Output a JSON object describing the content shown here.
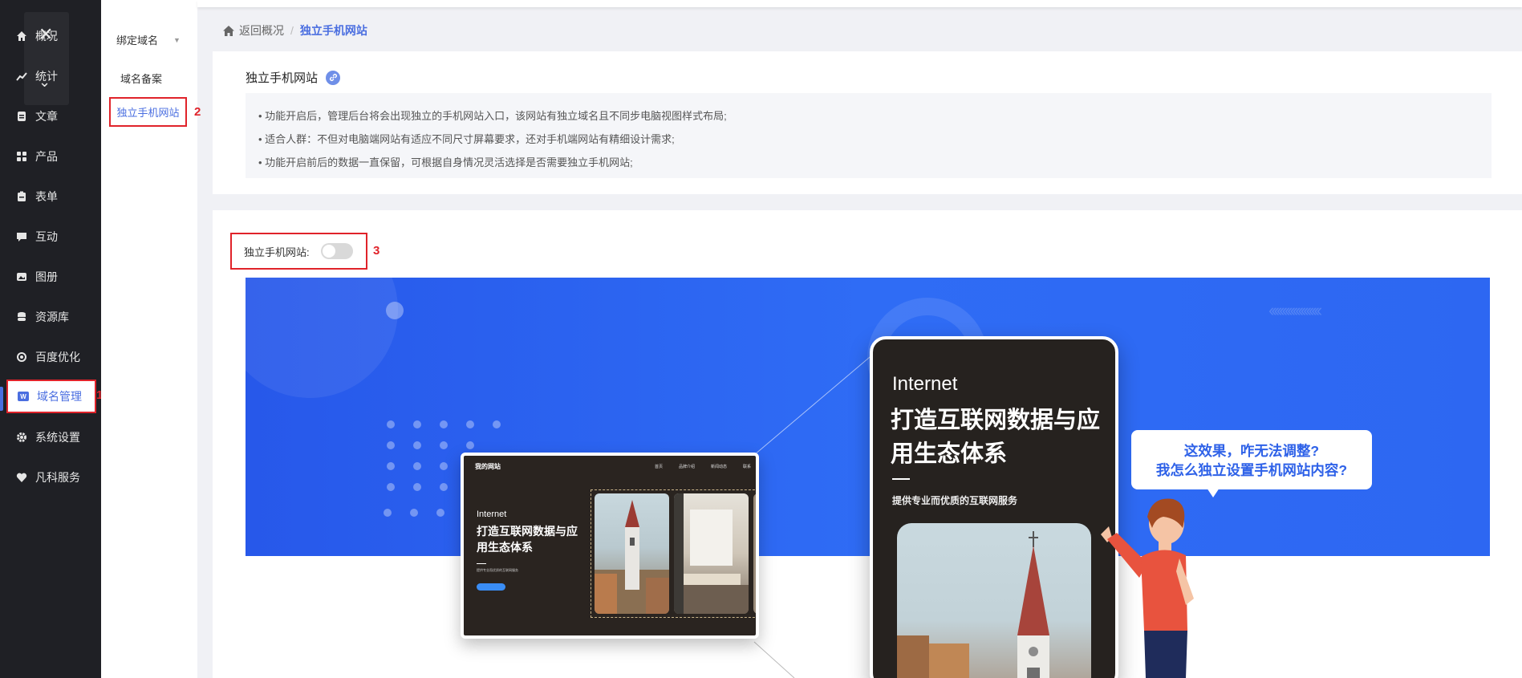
{
  "sidebar": {
    "items": [
      {
        "label": "概况",
        "icon": "home-icon"
      },
      {
        "label": "统计",
        "icon": "stats-icon"
      },
      {
        "label": "文章",
        "icon": "article-icon"
      },
      {
        "label": "产品",
        "icon": "grid-icon"
      },
      {
        "label": "表单",
        "icon": "form-icon"
      },
      {
        "label": "互动",
        "icon": "chat-icon"
      },
      {
        "label": "图册",
        "icon": "gallery-icon"
      },
      {
        "label": "资源库",
        "icon": "database-icon"
      },
      {
        "label": "百度优化",
        "icon": "seo-icon"
      },
      {
        "label": "域名管理",
        "icon": "domain-icon",
        "badge": "W"
      },
      {
        "label": "系统设置",
        "icon": "gear-icon"
      },
      {
        "label": "凡科服务",
        "icon": "heart-icon"
      }
    ],
    "active_index": 9
  },
  "annotations": {
    "a1": "1",
    "a2": "2",
    "a3": "3"
  },
  "subnav": {
    "group_title": "绑定域名",
    "items": [
      "域名备案",
      "独立手机网站"
    ]
  },
  "breadcrumb": {
    "back": "返回概况",
    "separator": "/",
    "current": "独立手机网站"
  },
  "intro": {
    "title": "独立手机网站",
    "lines": [
      "• 功能开启后，管理后台将会出现独立的手机网站入口，该网站有独立域名且不同步电脑视图样式布局;",
      "• 适合人群：不但对电脑端网站有适应不同尺寸屏幕要求，还对手机端网站有精细设计需求;",
      "• 功能开启前后的数据一直保留，可根据自身情况灵活选择是否需要独立手机网站;"
    ]
  },
  "toggle": {
    "label": "独立手机网站:",
    "enabled": false
  },
  "illustration": {
    "desktop": {
      "site_name": "我的网站",
      "menu": [
        "首页",
        "品牌介绍",
        "新闻动态",
        "联系"
      ],
      "internet": "Internet",
      "headline": "打造互联网数据与应用生态体系",
      "small": "提供专业而优质的互联网服务"
    },
    "phone": {
      "internet": "Internet",
      "headline": "打造互联网数据与应用生态体系",
      "subtitle": "提供专业而优质的互联网服务"
    },
    "bubble": {
      "line1": "这效果，咋无法调整?",
      "line2": "我怎么独立设置手机网站内容?"
    }
  },
  "colors": {
    "accent": "#4a6ee0",
    "sidebar_bg": "#1f2025",
    "annotation": "#e0232a",
    "banner": "#2f6cf5"
  }
}
